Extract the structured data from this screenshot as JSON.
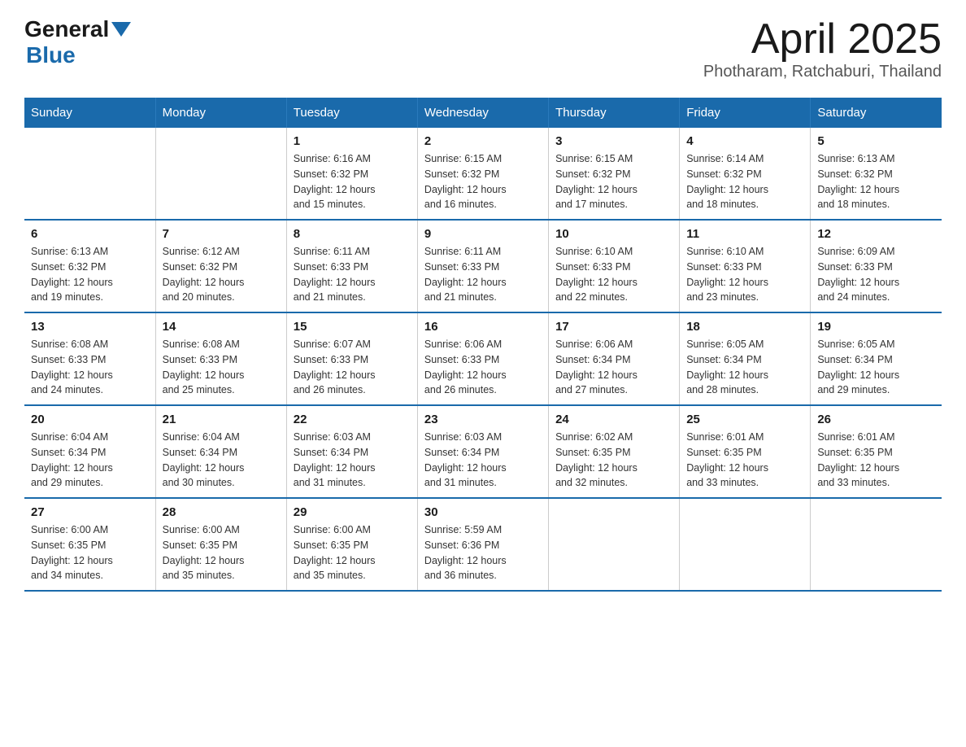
{
  "header": {
    "logo_general": "General",
    "logo_blue": "Blue",
    "title": "April 2025",
    "subtitle": "Photharam, Ratchaburi, Thailand"
  },
  "calendar": {
    "days_of_week": [
      "Sunday",
      "Monday",
      "Tuesday",
      "Wednesday",
      "Thursday",
      "Friday",
      "Saturday"
    ],
    "weeks": [
      [
        {
          "day": "",
          "info": ""
        },
        {
          "day": "",
          "info": ""
        },
        {
          "day": "1",
          "info": "Sunrise: 6:16 AM\nSunset: 6:32 PM\nDaylight: 12 hours\nand 15 minutes."
        },
        {
          "day": "2",
          "info": "Sunrise: 6:15 AM\nSunset: 6:32 PM\nDaylight: 12 hours\nand 16 minutes."
        },
        {
          "day": "3",
          "info": "Sunrise: 6:15 AM\nSunset: 6:32 PM\nDaylight: 12 hours\nand 17 minutes."
        },
        {
          "day": "4",
          "info": "Sunrise: 6:14 AM\nSunset: 6:32 PM\nDaylight: 12 hours\nand 18 minutes."
        },
        {
          "day": "5",
          "info": "Sunrise: 6:13 AM\nSunset: 6:32 PM\nDaylight: 12 hours\nand 18 minutes."
        }
      ],
      [
        {
          "day": "6",
          "info": "Sunrise: 6:13 AM\nSunset: 6:32 PM\nDaylight: 12 hours\nand 19 minutes."
        },
        {
          "day": "7",
          "info": "Sunrise: 6:12 AM\nSunset: 6:32 PM\nDaylight: 12 hours\nand 20 minutes."
        },
        {
          "day": "8",
          "info": "Sunrise: 6:11 AM\nSunset: 6:33 PM\nDaylight: 12 hours\nand 21 minutes."
        },
        {
          "day": "9",
          "info": "Sunrise: 6:11 AM\nSunset: 6:33 PM\nDaylight: 12 hours\nand 21 minutes."
        },
        {
          "day": "10",
          "info": "Sunrise: 6:10 AM\nSunset: 6:33 PM\nDaylight: 12 hours\nand 22 minutes."
        },
        {
          "day": "11",
          "info": "Sunrise: 6:10 AM\nSunset: 6:33 PM\nDaylight: 12 hours\nand 23 minutes."
        },
        {
          "day": "12",
          "info": "Sunrise: 6:09 AM\nSunset: 6:33 PM\nDaylight: 12 hours\nand 24 minutes."
        }
      ],
      [
        {
          "day": "13",
          "info": "Sunrise: 6:08 AM\nSunset: 6:33 PM\nDaylight: 12 hours\nand 24 minutes."
        },
        {
          "day": "14",
          "info": "Sunrise: 6:08 AM\nSunset: 6:33 PM\nDaylight: 12 hours\nand 25 minutes."
        },
        {
          "day": "15",
          "info": "Sunrise: 6:07 AM\nSunset: 6:33 PM\nDaylight: 12 hours\nand 26 minutes."
        },
        {
          "day": "16",
          "info": "Sunrise: 6:06 AM\nSunset: 6:33 PM\nDaylight: 12 hours\nand 26 minutes."
        },
        {
          "day": "17",
          "info": "Sunrise: 6:06 AM\nSunset: 6:34 PM\nDaylight: 12 hours\nand 27 minutes."
        },
        {
          "day": "18",
          "info": "Sunrise: 6:05 AM\nSunset: 6:34 PM\nDaylight: 12 hours\nand 28 minutes."
        },
        {
          "day": "19",
          "info": "Sunrise: 6:05 AM\nSunset: 6:34 PM\nDaylight: 12 hours\nand 29 minutes."
        }
      ],
      [
        {
          "day": "20",
          "info": "Sunrise: 6:04 AM\nSunset: 6:34 PM\nDaylight: 12 hours\nand 29 minutes."
        },
        {
          "day": "21",
          "info": "Sunrise: 6:04 AM\nSunset: 6:34 PM\nDaylight: 12 hours\nand 30 minutes."
        },
        {
          "day": "22",
          "info": "Sunrise: 6:03 AM\nSunset: 6:34 PM\nDaylight: 12 hours\nand 31 minutes."
        },
        {
          "day": "23",
          "info": "Sunrise: 6:03 AM\nSunset: 6:34 PM\nDaylight: 12 hours\nand 31 minutes."
        },
        {
          "day": "24",
          "info": "Sunrise: 6:02 AM\nSunset: 6:35 PM\nDaylight: 12 hours\nand 32 minutes."
        },
        {
          "day": "25",
          "info": "Sunrise: 6:01 AM\nSunset: 6:35 PM\nDaylight: 12 hours\nand 33 minutes."
        },
        {
          "day": "26",
          "info": "Sunrise: 6:01 AM\nSunset: 6:35 PM\nDaylight: 12 hours\nand 33 minutes."
        }
      ],
      [
        {
          "day": "27",
          "info": "Sunrise: 6:00 AM\nSunset: 6:35 PM\nDaylight: 12 hours\nand 34 minutes."
        },
        {
          "day": "28",
          "info": "Sunrise: 6:00 AM\nSunset: 6:35 PM\nDaylight: 12 hours\nand 35 minutes."
        },
        {
          "day": "29",
          "info": "Sunrise: 6:00 AM\nSunset: 6:35 PM\nDaylight: 12 hours\nand 35 minutes."
        },
        {
          "day": "30",
          "info": "Sunrise: 5:59 AM\nSunset: 6:36 PM\nDaylight: 12 hours\nand 36 minutes."
        },
        {
          "day": "",
          "info": ""
        },
        {
          "day": "",
          "info": ""
        },
        {
          "day": "",
          "info": ""
        }
      ]
    ]
  }
}
